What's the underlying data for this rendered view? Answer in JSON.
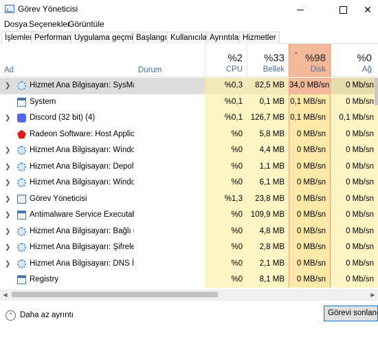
{
  "window": {
    "title": "Görev Yöneticisi",
    "icon": "task-manager-icon"
  },
  "menu": [
    "Dosya",
    "Seçenekler",
    "Görüntüle"
  ],
  "tabs": [
    "İşlemler",
    "Performans",
    "Uygulama geçmişi",
    "Başlangıç",
    "Kullanıcılar",
    "Ayrıntılar",
    "Hizmetler"
  ],
  "active_tab": "İşlemler",
  "columns": {
    "name": "Ad",
    "status": "Durum",
    "cpu": {
      "pct": "%2",
      "label": "CPU"
    },
    "memory": {
      "pct": "%33",
      "label": "Bellek"
    },
    "disk": {
      "pct": "%98",
      "label": "Disk"
    },
    "network": {
      "pct": "%0",
      "label": "Ağ"
    }
  },
  "processes": [
    {
      "name": "Hizmet Ana Bilgisayarı: SysMain",
      "icon": "gear-icon",
      "expandable": true,
      "cpu": "%0,3",
      "memory": "82,5 MB",
      "disk": "34,0 MB/sn",
      "network": "0 Mb/sn",
      "selected": true
    },
    {
      "name": "System",
      "icon": "window-icon",
      "expandable": false,
      "cpu": "%0,1",
      "memory": "0,1 MB",
      "disk": "0,1 MB/sn",
      "network": "0 Mb/sn"
    },
    {
      "name": "Discord (32 bit) (4)",
      "icon": "discord-icon",
      "expandable": true,
      "cpu": "%0,1",
      "memory": "126,7 MB",
      "disk": "0,1 MB/sn",
      "network": "0,1 Mb/sn"
    },
    {
      "name": "Radeon Software: Host Applicat...",
      "icon": "radeon-icon",
      "expandable": false,
      "cpu": "%0",
      "memory": "5,8 MB",
      "disk": "0 MB/sn",
      "network": "0 Mb/sn"
    },
    {
      "name": "Hizmet Ana Bilgisayarı: Window...",
      "icon": "gear-icon",
      "expandable": true,
      "cpu": "%0",
      "memory": "4,4 MB",
      "disk": "0 MB/sn",
      "network": "0 Mb/sn"
    },
    {
      "name": "Hizmet Ana Bilgisayarı: Depola...",
      "icon": "gear-icon",
      "expandable": true,
      "cpu": "%0",
      "memory": "1,1 MB",
      "disk": "0 MB/sn",
      "network": "0 Mb/sn"
    },
    {
      "name": "Hizmet Ana Bilgisayarı: Window...",
      "icon": "gear-icon",
      "expandable": true,
      "cpu": "%0",
      "memory": "6,1 MB",
      "disk": "0 MB/sn",
      "network": "0 Mb/sn"
    },
    {
      "name": "Görev Yöneticisi",
      "icon": "task-manager-icon",
      "expandable": true,
      "cpu": "%1,3",
      "memory": "23,8 MB",
      "disk": "0 MB/sn",
      "network": "0 Mb/sn"
    },
    {
      "name": "Antimalware Service Executable",
      "icon": "window-icon",
      "expandable": true,
      "cpu": "%0",
      "memory": "109,9 MB",
      "disk": "0 MB/sn",
      "network": "0 Mb/sn"
    },
    {
      "name": "Hizmet Ana Bilgisayarı: Bağlı Ci...",
      "icon": "gear-icon",
      "expandable": true,
      "cpu": "%0",
      "memory": "4,8 MB",
      "disk": "0 MB/sn",
      "network": "0 Mb/sn"
    },
    {
      "name": "Hizmet Ana Bilgisayarı: Şifrelem...",
      "icon": "gear-icon",
      "expandable": true,
      "cpu": "%0",
      "memory": "2,8 MB",
      "disk": "0 MB/sn",
      "network": "0 Mb/sn"
    },
    {
      "name": "Hizmet Ana Bilgisayarı: DNS İst...",
      "icon": "gear-icon",
      "expandable": true,
      "cpu": "%0",
      "memory": "2,1 MB",
      "disk": "0 MB/sn",
      "network": "0 Mb/sn"
    },
    {
      "name": "Registry",
      "icon": "window-icon",
      "expandable": false,
      "cpu": "%0",
      "memory": "8,1 MB",
      "disk": "0 MB/sn",
      "network": "0 Mb/sn"
    }
  ],
  "footer": {
    "less_details": "Daha az ayrıntı",
    "end_task": "Görevi sonlandır"
  },
  "colors": {
    "heat_light": "#fff4c4",
    "heat_disk": "#ffe9a8",
    "sorted_header": "#f4b99a",
    "accent": "#0078d7"
  }
}
